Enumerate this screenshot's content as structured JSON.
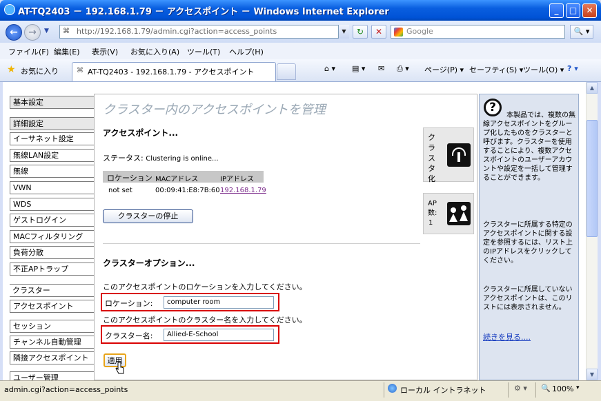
{
  "window": {
    "title": "AT-TQ2403 － 192.168.1.79 － アクセスポイント － Windows Internet Explorer",
    "minimize": "_",
    "maximize": "□",
    "close": "✕"
  },
  "address": {
    "url": "http://192.168.1.79/admin.cgi?action=access_points",
    "search_placeholder": "Google",
    "back": "←",
    "forward": "→",
    "refresh": "↻",
    "stop": "✕",
    "search_go": "🔍 ▾",
    "drop": "▼"
  },
  "menu": [
    "ファイル(F)",
    "編集(E)",
    "表示(V)",
    "お気に入り(A)",
    "ツール(T)",
    "ヘルプ(H)"
  ],
  "favorites": {
    "label": "お気に入り"
  },
  "tab": {
    "label": "AT-TQ2403 - 192.168.1.79 - アクセスポイント"
  },
  "commandbar": {
    "home": "⌂ ▾",
    "feeds": "▤ ▾",
    "mail": "✉",
    "print": "⎙ ▾",
    "page": "ページ(P) ▾",
    "safety": "セーフティ(S) ▾",
    "tools": "ツール(O) ▾",
    "help": "? ▾"
  },
  "sidebar": {
    "group1": [
      "基本設定"
    ],
    "group2": [
      "詳細設定",
      "イーサネット設定",
      "無線LAN設定",
      "無線",
      "VWN",
      "WDS",
      "ゲストログイン",
      "MACフィルタリング",
      "負荷分散",
      "不正APトラップ"
    ],
    "group3": [
      "クラスター",
      "アクセスポイント"
    ],
    "group4": [
      "セッション",
      "チャンネル自動管理",
      "隣接アクセスポイント"
    ],
    "group5": [
      "ユーザー管理"
    ]
  },
  "content": {
    "title": "クラスター内のアクセスポイントを管理",
    "ap_heading": "アクセスポイント...",
    "status_label": "ステータス:",
    "status_value": "Clustering is online...",
    "table": {
      "headers": [
        "ロケーション",
        "MACアドレス",
        "IPアドレス"
      ],
      "rows": [
        {
          "location": "not set",
          "mac": "00:09:41:E8:7B:60",
          "ip": "192.168.1.79"
        }
      ]
    },
    "stop_button": "クラスターの停止",
    "cluster_icon_label": "クラスタ化",
    "ap_count_label": "AP数:",
    "ap_count": "1",
    "options_heading": "クラスターオプション...",
    "location_prompt": "このアクセスポイントのロケーションを入力してください。",
    "location_label": "ロケーション:",
    "location_value": "computer room",
    "cluster_prompt": "このアクセスポイントのクラスター名を入力してください。",
    "cluster_label": "クラスター名:",
    "cluster_value": "Allied-E-School",
    "apply_button": "適用"
  },
  "help": {
    "para1": "本製品では、複数の無線アクセスポイントをグループ化したものをクラスターと呼びます。クラスターを使用することにより、複数アクセスポイントのユーザーアカウントや設定を一括して管理することができます。",
    "para2": "クラスターに所属する特定のアクセスポイントに関する設定を参照するには、リスト上のIPアドレスをクリックしてください。",
    "para3": "クラスターに所属していないアクセスポイントは、このリストには表示されません。",
    "more_link": "続きを見る...."
  },
  "status": {
    "url": "admin.cgi?action=access_points",
    "zone": "ローカル イントラネット",
    "zoom": "100%"
  },
  "colors": {
    "titlebar": "#0a5fe0",
    "link": "#7a2a8a",
    "highlight": "#d90000"
  }
}
